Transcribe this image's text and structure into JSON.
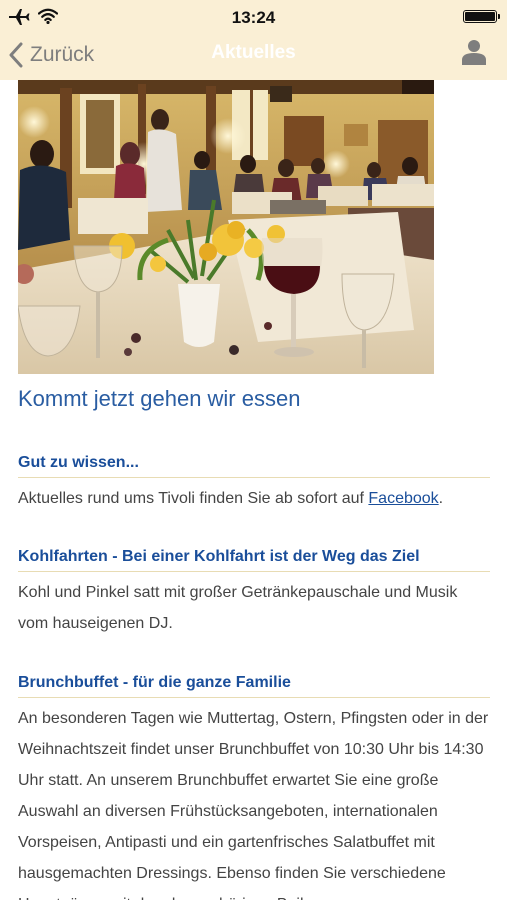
{
  "status_bar": {
    "time": "13:24"
  },
  "nav": {
    "back_label": "Zurück",
    "title": "Aktuelles"
  },
  "article": {
    "headline": "Kommt jetzt gehen wir essen",
    "sections": [
      {
        "heading": "Gut zu wissen...",
        "body_text": "Aktuelles rund ums Tivoli finden Sie ab sofort auf ",
        "link": "Facebook",
        "after_link": "."
      },
      {
        "heading": "Kohlfahrten - Bei einer Kohlfahrt ist der Weg das Ziel",
        "body_text": "Kohl und Pinkel satt mit großer Getränkepauschale und Musik vom hauseigenen DJ."
      },
      {
        "heading": "Brunchbuffet - für die ganze Familie",
        "body_text": "An besonderen Tagen wie Muttertag, Ostern, Pfingsten oder in der Weihnachtszeit findet unser Brunchbuffet von 10:30 Uhr bis 14:30 Uhr statt. An unserem Brunchbuffet erwartet Sie eine große Auswahl an diversen Frühstücksangeboten, internationalen Vorspeisen, Antipasti und ein gartenfrisches Salatbuffet mit hausgemachten Dressings. Ebenso finden Sie verschiedene Hauptgänge mit den dazugehörigen Beilagen."
      }
    ]
  },
  "colors": {
    "nav_background": "#faefd5",
    "heading_blue": "#1a4e9a",
    "headline_blue": "#2a5da2",
    "divider": "#e8dcb4"
  },
  "icons": [
    "airplane-icon",
    "wifi-icon",
    "battery-icon",
    "chevron-left-icon",
    "user-icon"
  ]
}
